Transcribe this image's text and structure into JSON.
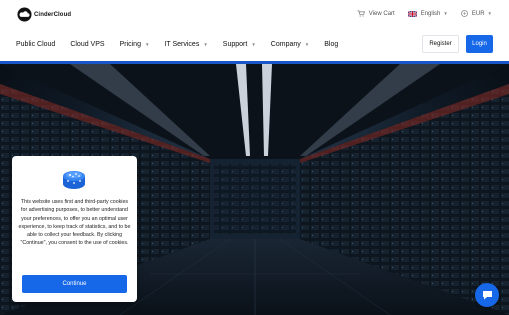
{
  "brand": {
    "name": "CinderCloud"
  },
  "topbar": {
    "cart_label": "View Cart",
    "language": "English",
    "currency": "EUR"
  },
  "nav": {
    "items": [
      {
        "label": "Public Cloud",
        "dropdown": false
      },
      {
        "label": "Cloud VPS",
        "dropdown": false
      },
      {
        "label": "Pricing",
        "dropdown": true
      },
      {
        "label": "IT Services",
        "dropdown": true
      },
      {
        "label": "Support",
        "dropdown": true
      },
      {
        "label": "Company",
        "dropdown": true
      },
      {
        "label": "Blog",
        "dropdown": false
      }
    ],
    "register_label": "Register",
    "login_label": "Login"
  },
  "hero": {
    "image": "data-center-server-aisle"
  },
  "cookie_banner": {
    "icon": "cookie-jar-icon",
    "text": "This website uses first and third-party cookies for advertising purposes, to better understand your preferences, to offer you an optimal user experience, to keep track of statistics, and to be able to collect your feedback. By clicking \"Continue\", you consent to the use of cookies.",
    "continue_label": "Continue"
  },
  "chat": {
    "icon": "chat-bubble-icon"
  },
  "colors": {
    "accent": "#1668e8",
    "stripe": "#1a56c7",
    "hero_bg": "#05080d"
  }
}
